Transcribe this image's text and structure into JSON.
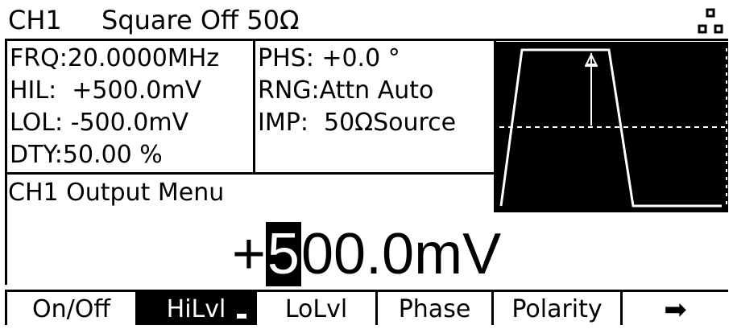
{
  "header": {
    "channel": "CH1",
    "mode": "Square Off 50Ω",
    "corner_icon": "network-dots-icon"
  },
  "params_left": {
    "frq": "FRQ:20.0000MHz",
    "hil": "HIL:  +500.0mV",
    "lol": "LOL: -500.0mV",
    "dty": "DTY:50.00 %"
  },
  "params_mid": {
    "phs": "PHS: +0.0 °",
    "rng": "RNG:Attn Auto",
    "imp": "IMP:  50ΩSource"
  },
  "menu_title": "CH1 Output Menu",
  "value": {
    "sign": "+",
    "cursor_digit": "5",
    "rest": "00.0mV"
  },
  "softkeys": [
    "On/Off",
    "HiLvl",
    "LoLvl",
    "Phase",
    "Polarity",
    "➡"
  ],
  "colors": {
    "background": "#ffffff",
    "foreground": "#000000"
  }
}
